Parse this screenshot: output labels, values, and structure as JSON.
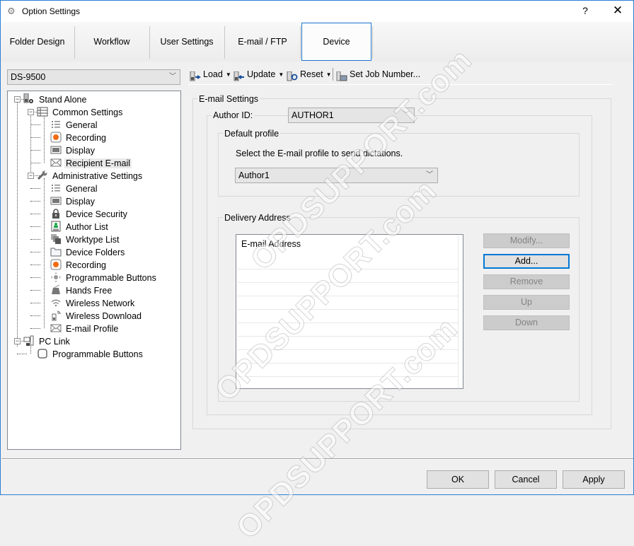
{
  "window": {
    "title": "Option Settings",
    "help_label": "?",
    "close_label": "✕"
  },
  "tabs": [
    {
      "label": "Folder Design",
      "active": false
    },
    {
      "label": "Workflow",
      "active": false
    },
    {
      "label": "User Settings",
      "active": false
    },
    {
      "label": "E-mail / FTP",
      "active": false
    },
    {
      "label": "Device",
      "active": true
    }
  ],
  "device_selector": {
    "value": "DS-9500"
  },
  "tree": {
    "items": [
      {
        "label": "Stand Alone",
        "icon": "device-gear-icon",
        "level": 0,
        "expander": "−"
      },
      {
        "label": "Common Settings",
        "icon": "list-settings-icon",
        "level": 1,
        "expander": "−"
      },
      {
        "label": "General",
        "icon": "list-icon",
        "level": 2
      },
      {
        "label": "Recording",
        "icon": "record-icon",
        "level": 2
      },
      {
        "label": "Display",
        "icon": "display-icon",
        "level": 2
      },
      {
        "label": "Recipient E-mail",
        "icon": "envelope-icon",
        "level": 2,
        "selected": true
      },
      {
        "label": "Administrative Settings",
        "icon": "wrench-icon",
        "level": 1,
        "expander": "−"
      },
      {
        "label": "General",
        "icon": "list-icon",
        "level": 2
      },
      {
        "label": "Display",
        "icon": "display-icon",
        "level": 2
      },
      {
        "label": "Device Security",
        "icon": "lock-icon",
        "level": 2
      },
      {
        "label": "Author List",
        "icon": "author-list-icon",
        "level": 2
      },
      {
        "label": "Worktype List",
        "icon": "worktype-list-icon",
        "level": 2
      },
      {
        "label": "Device Folders",
        "icon": "folder-icon",
        "level": 2
      },
      {
        "label": "Recording",
        "icon": "record-icon",
        "level": 2
      },
      {
        "label": "Programmable Buttons",
        "icon": "dpad-icon",
        "level": 2
      },
      {
        "label": "Hands Free",
        "icon": "foot-pedal-icon",
        "level": 2
      },
      {
        "label": "Wireless Network",
        "icon": "wifi-icon",
        "level": 2
      },
      {
        "label": "Wireless Download",
        "icon": "wireless-download-icon",
        "level": 2
      },
      {
        "label": "E-mail Profile",
        "icon": "envelope-icon",
        "level": 2
      },
      {
        "label": "PC Link",
        "icon": "pc-link-icon",
        "level": 0,
        "expander": "−"
      },
      {
        "label": "Programmable Buttons",
        "icon": "button-icon",
        "level": 1
      }
    ]
  },
  "toolbar": {
    "load_label": "Load",
    "update_label": "Update",
    "reset_label": "Reset",
    "set_job_number_label": "Set Job Number..."
  },
  "email_settings": {
    "group_label": "E-mail Settings",
    "author_id_label": "Author ID:",
    "author_id_value": "AUTHOR1",
    "default_profile": {
      "group_label": "Default profile",
      "instruction": "Select the E-mail profile to send dictations.",
      "profile_value": "Author1"
    },
    "delivery_address": {
      "group_label": "Delivery Address",
      "column_header": "E-mail Address",
      "rows": [],
      "buttons": [
        {
          "label": "Modify...",
          "enabled": false
        },
        {
          "label": "Add...",
          "enabled": true,
          "default": true
        },
        {
          "label": "Remove",
          "enabled": false
        },
        {
          "label": "Up",
          "enabled": false
        },
        {
          "label": "Down",
          "enabled": false
        }
      ]
    }
  },
  "footer": {
    "ok_label": "OK",
    "cancel_label": "Cancel",
    "apply_label": "Apply"
  },
  "watermark": {
    "text": "OPDSUPPORT.com"
  }
}
